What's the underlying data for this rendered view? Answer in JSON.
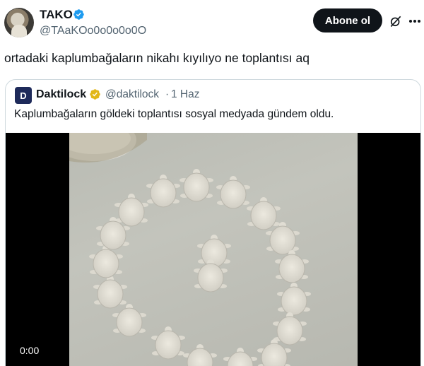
{
  "author": {
    "display_name": "TAKO",
    "handle": "@TAaKOo0o0o0o0O",
    "follow_label": "Abone ol"
  },
  "tweet": {
    "text": "ortadaki kaplumbağaların nikahı kıyılıyo ne toplantısı aq"
  },
  "quote": {
    "avatar_letter": "D",
    "display_name": "Daktilock",
    "handle": "@daktilock",
    "separator": "·",
    "time": "1 Haz",
    "text": "Kaplumbağaların göldeki toplantısı sosyal medyada gündem oldu.",
    "video_time": "0:00"
  },
  "colors": {
    "verified_blue": "#1d9bf0",
    "verified_gold": "#e2b719",
    "follow_bg": "#0f1419"
  },
  "icons": {
    "verified": "verified-badge-icon",
    "grok": "grok-icon",
    "more": "more-icon"
  }
}
